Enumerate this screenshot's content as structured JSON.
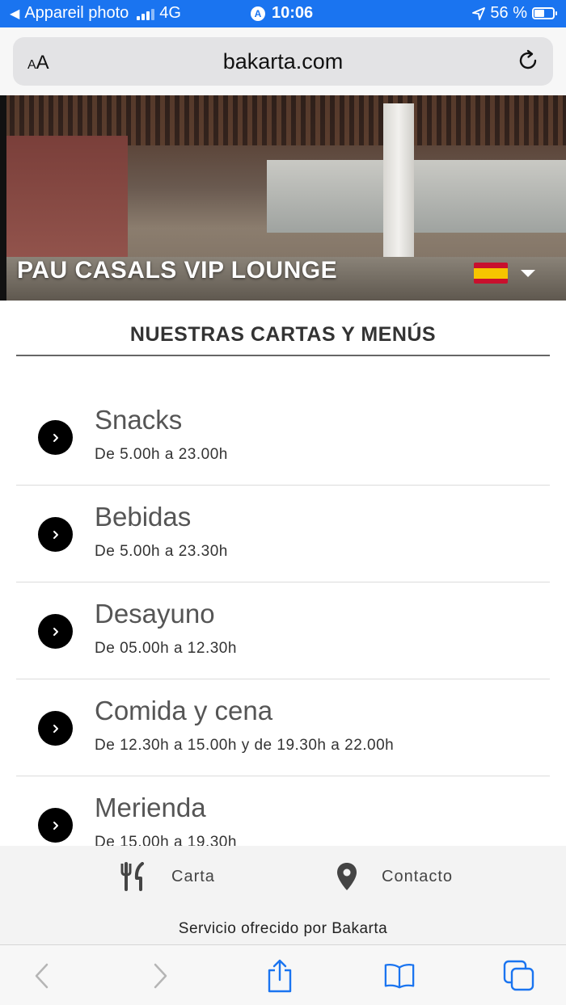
{
  "status_bar": {
    "carrier": "Appareil photo",
    "network": "4G",
    "time": "10:06",
    "battery_percent": "56 %",
    "battery_level": 0.56
  },
  "browser": {
    "text_size_label": "AA",
    "domain": "bakarta.com"
  },
  "hero": {
    "title": "PAU CASALS VIP LOUNGE",
    "language_flag": "spain-flag"
  },
  "section": {
    "title": "NUESTRAS CARTAS Y MENÚS"
  },
  "menus": [
    {
      "name": "Snacks",
      "hours": "De 5.00h a 23.00h"
    },
    {
      "name": "Bebidas",
      "hours": "De 5.00h a 23.30h"
    },
    {
      "name": "Desayuno",
      "hours": "De 05.00h a 12.30h"
    },
    {
      "name": "Comida y cena",
      "hours": "De 12.30h a 15.00h y de 19.30h a 22.00h"
    },
    {
      "name": "Merienda",
      "hours": "De 15.00h a 19.30h"
    }
  ],
  "footer": {
    "carta_label": "Carta",
    "contacto_label": "Contacto",
    "service_text": "Servicio ofrecido por Bakarta"
  },
  "colors": {
    "status_bar_bg": "#1a74f0",
    "accent_black": "#000000"
  }
}
